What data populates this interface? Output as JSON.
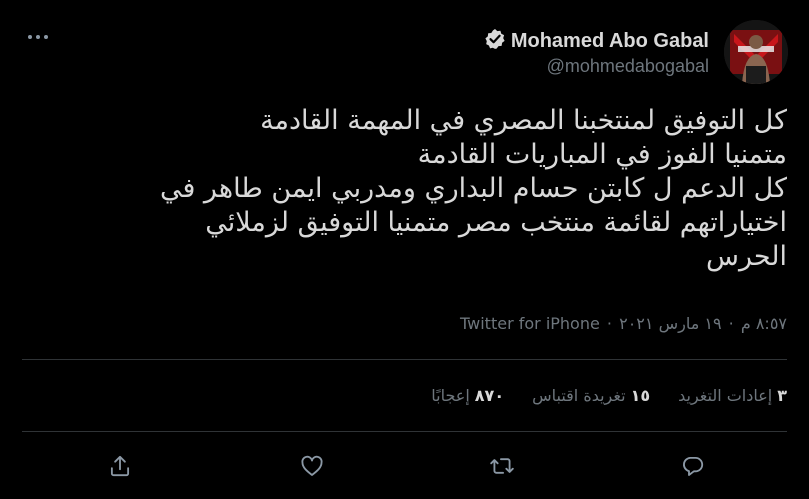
{
  "tweet": {
    "author": {
      "display_name": "Mohamed Abo Gabal",
      "handle": "@mohmedabogabal",
      "verified": true
    },
    "text_lines": [
      "كل التوفيق لمنتخبنا المصري في المهمة القادمة",
      "متمنيا الفوز في المباريات القادمة",
      "كل الدعم ل كابتن حسام البداري ومدربي ايمن طاهر في",
      "اختياراتهم لقائمة منتخب مصر متمنيا التوفيق لزملائي",
      "الحرس"
    ],
    "meta": {
      "time": "٨:٥٧ م",
      "separator": "·",
      "date": "١٩ مارس ٢٠٢١",
      "source": "Twitter for iPhone"
    },
    "stats": [
      {
        "count": "٣",
        "label": "إعادات التغريد"
      },
      {
        "count": "١٥",
        "label": "تغريدة اقتباس"
      },
      {
        "count": "٨٧٠",
        "label": "إعجابًا"
      }
    ]
  },
  "icons": {
    "more": "more-horizontal-icon",
    "verified": "verified-badge-icon",
    "reply": "reply-icon",
    "retweet": "retweet-icon",
    "like": "heart-icon",
    "share": "share-icon"
  },
  "colors": {
    "background": "#000000",
    "primary_text": "#d9d9d9",
    "secondary_text": "#6e767d",
    "divider": "#2f3336",
    "icon": "#8b98a5"
  }
}
